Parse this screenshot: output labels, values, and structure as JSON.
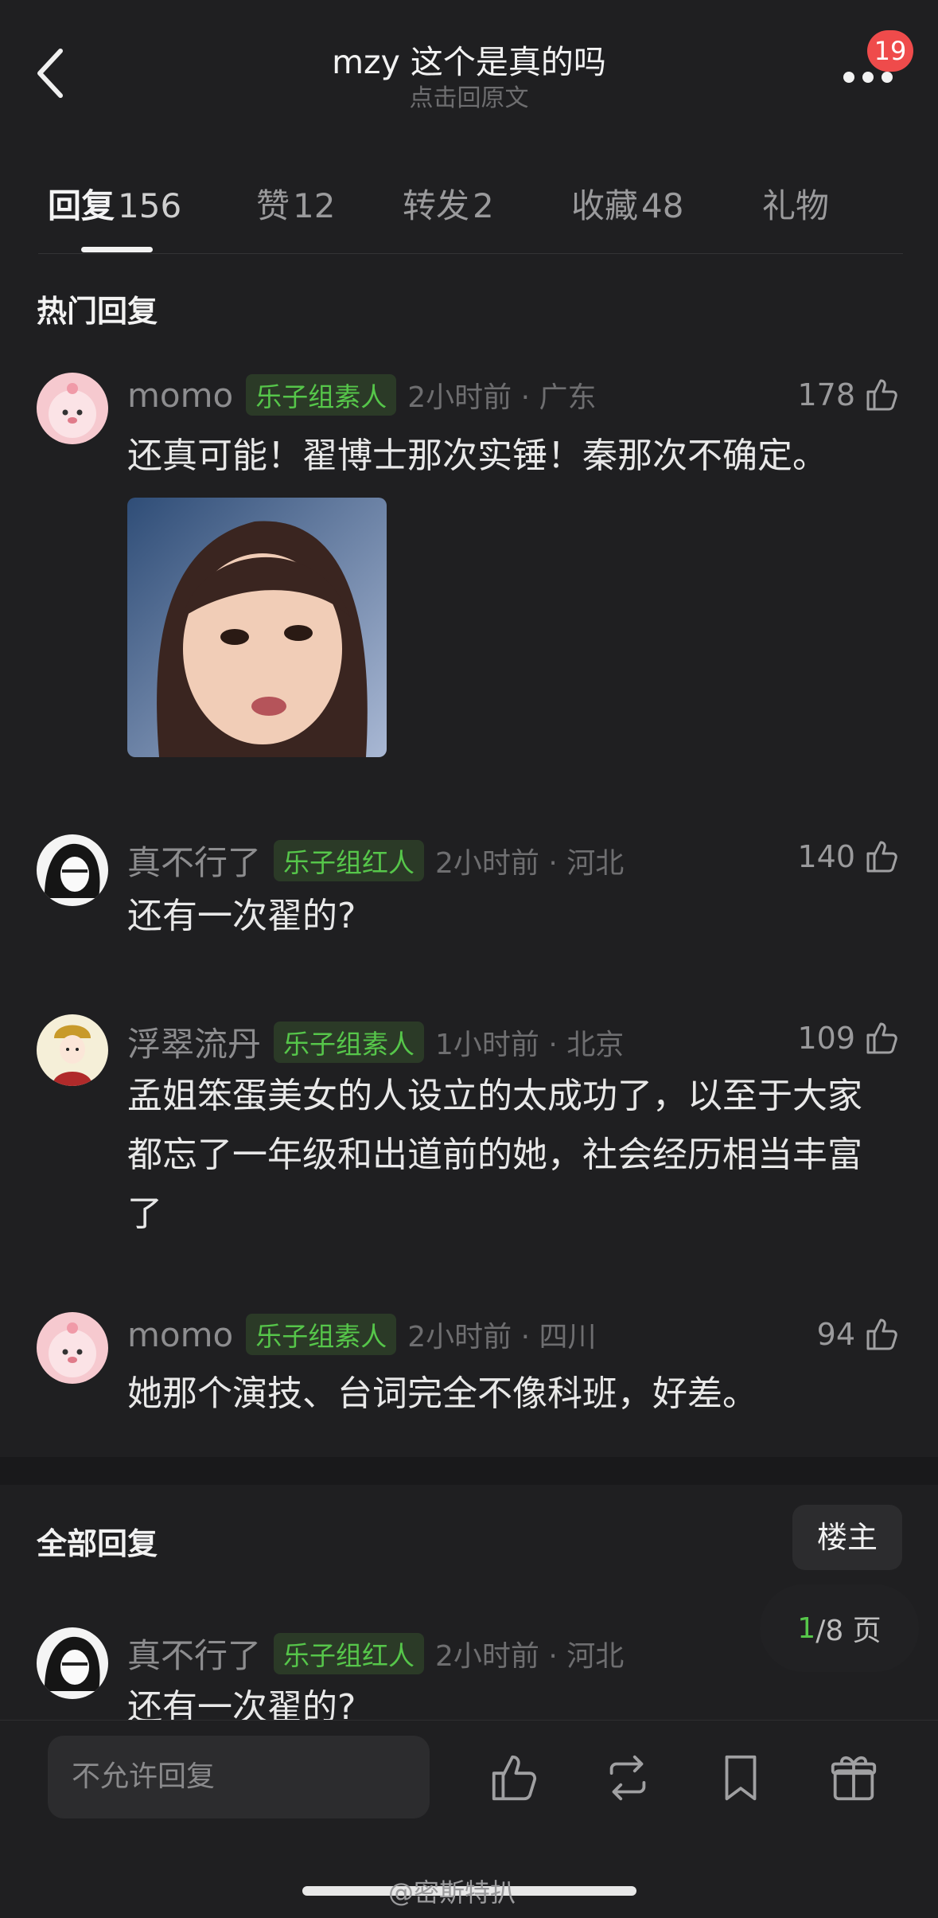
{
  "header": {
    "title": "mzy 这个是真的吗",
    "subtitle": "点击回原文",
    "badge_count": "19"
  },
  "tabs": [
    {
      "label": "回复",
      "count": "156",
      "active": true
    },
    {
      "label": "赞",
      "count": "12"
    },
    {
      "label": "转发",
      "count": "2"
    },
    {
      "label": "收藏",
      "count": "48"
    },
    {
      "label": "礼物",
      "count": ""
    }
  ],
  "hot_section_title": "热门回复",
  "hot_comments": [
    {
      "user": "momo",
      "tag": "乐子组素人",
      "time": "2小时前 · 广东",
      "likes": "178",
      "text": "还真可能！翟博士那次实锤！秦那次不确定。",
      "avatar": "pink-blob-avatar"
    },
    {
      "user": "真不行了",
      "tag": "乐子组红人",
      "time": "2小时前 · 河北",
      "likes": "140",
      "text": "还有一次翟的?",
      "avatar": "ink-girl-avatar"
    },
    {
      "user": "浮翠流丹",
      "tag": "乐子组素人",
      "time": "1小时前 · 北京",
      "likes": "109",
      "text": "孟姐笨蛋美女的人设立的太成功了，以至于大家都忘了一年级和出道前的她，社会经历相当丰富了",
      "avatar": "opera-girl-avatar"
    },
    {
      "user": "momo",
      "tag": "乐子组素人",
      "time": "2小时前 · 四川",
      "likes": "94",
      "text": "她那个演技、台词完全不像科班，好差。",
      "avatar": "pink-blob-avatar"
    }
  ],
  "all_section_title": "全部回复",
  "owner_button": "楼主",
  "pagination": {
    "current": "1",
    "total_text": "/8 页"
  },
  "all_comments": [
    {
      "user": "真不行了",
      "tag": "乐子组红人",
      "time": "2小时前 · 河北",
      "text": "还有一次翟的?",
      "avatar": "ink-girl-avatar"
    }
  ],
  "bottom_bar": {
    "reply_placeholder": "不允许回复",
    "icons": [
      "thumbs-up-icon",
      "repost-icon",
      "bookmark-icon",
      "gift-icon"
    ]
  },
  "watermark": "@密斯特扒"
}
